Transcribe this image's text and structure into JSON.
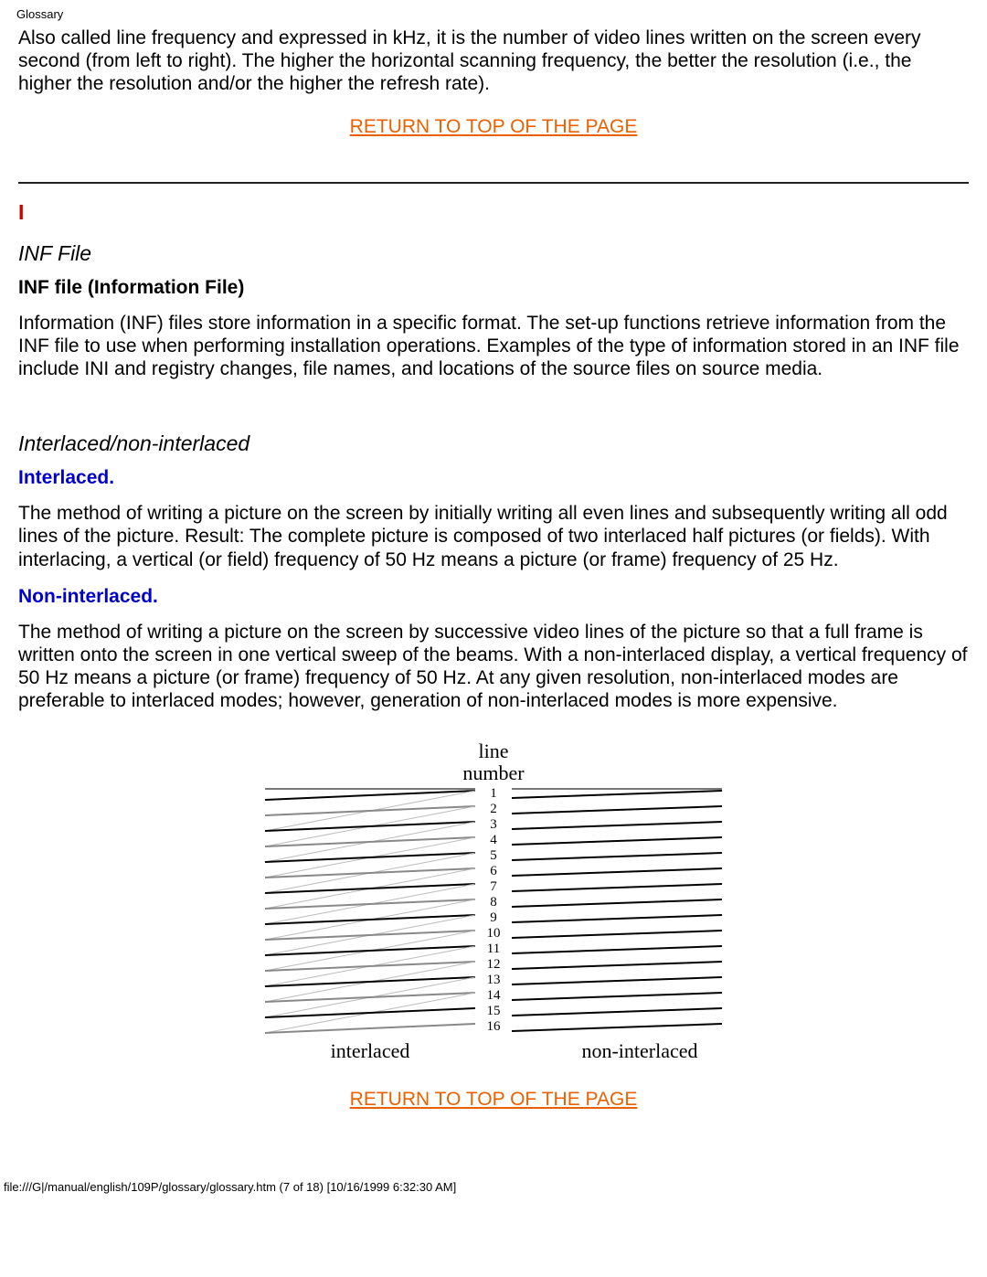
{
  "header": {
    "title": "Glossary"
  },
  "intro": {
    "para": "Also called line frequency and expressed in kHz, it is the number of video lines written on the screen every second (from left to right). The higher the horizontal scanning frequency, the better the resolution (i.e., the higher the resolution and/or the higher the refresh rate)."
  },
  "links": {
    "return_top": "RETURN TO TOP OF THE PAGE"
  },
  "section": {
    "letter": "I",
    "inf": {
      "title": "INF File",
      "sub": "INF file (Information File)",
      "para": "Information (INF) files store information in a specific format. The set-up functions retrieve information from the INF file to use when performing installation operations. Examples of the type of information stored in an INF file include INI and registry changes, file names, and locations of the source files on source media."
    },
    "interlace": {
      "title": "Interlaced/non-interlaced",
      "sub1": "Interlaced.",
      "para1": "The method of writing a picture on the screen by initially writing all even lines and subsequently writing all odd lines of the picture. Result: The complete picture is composed of two interlaced half pictures (or fields). With interlacing, a vertical (or field) frequency of 50 Hz means a picture (or frame) frequency of 25 Hz.",
      "sub2": "Non-interlaced.",
      "para2": "The method of writing a picture on the screen by successive video lines of the picture so that a full frame is written onto the screen in one vertical sweep of the beams. With a non-interlaced display, a vertical frequency of 50 Hz means a picture (or frame) frequency of 50 Hz. At any given resolution, non-interlaced modes are preferable to interlaced modes; however, generation of non-interlaced modes is more expensive."
    }
  },
  "diagram": {
    "title1": "line",
    "title2": "number",
    "left_label": "interlaced",
    "right_label": "non-interlaced",
    "line_numbers": [
      "1",
      "2",
      "3",
      "4",
      "5",
      "6",
      "7",
      "8",
      "9",
      "10",
      "11",
      "12",
      "13",
      "14",
      "15",
      "16"
    ]
  },
  "footer": {
    "text": "file:///G|/manual/english/109P/glossary/glossary.htm (7 of 18) [10/16/1999 6:32:30 AM]"
  }
}
